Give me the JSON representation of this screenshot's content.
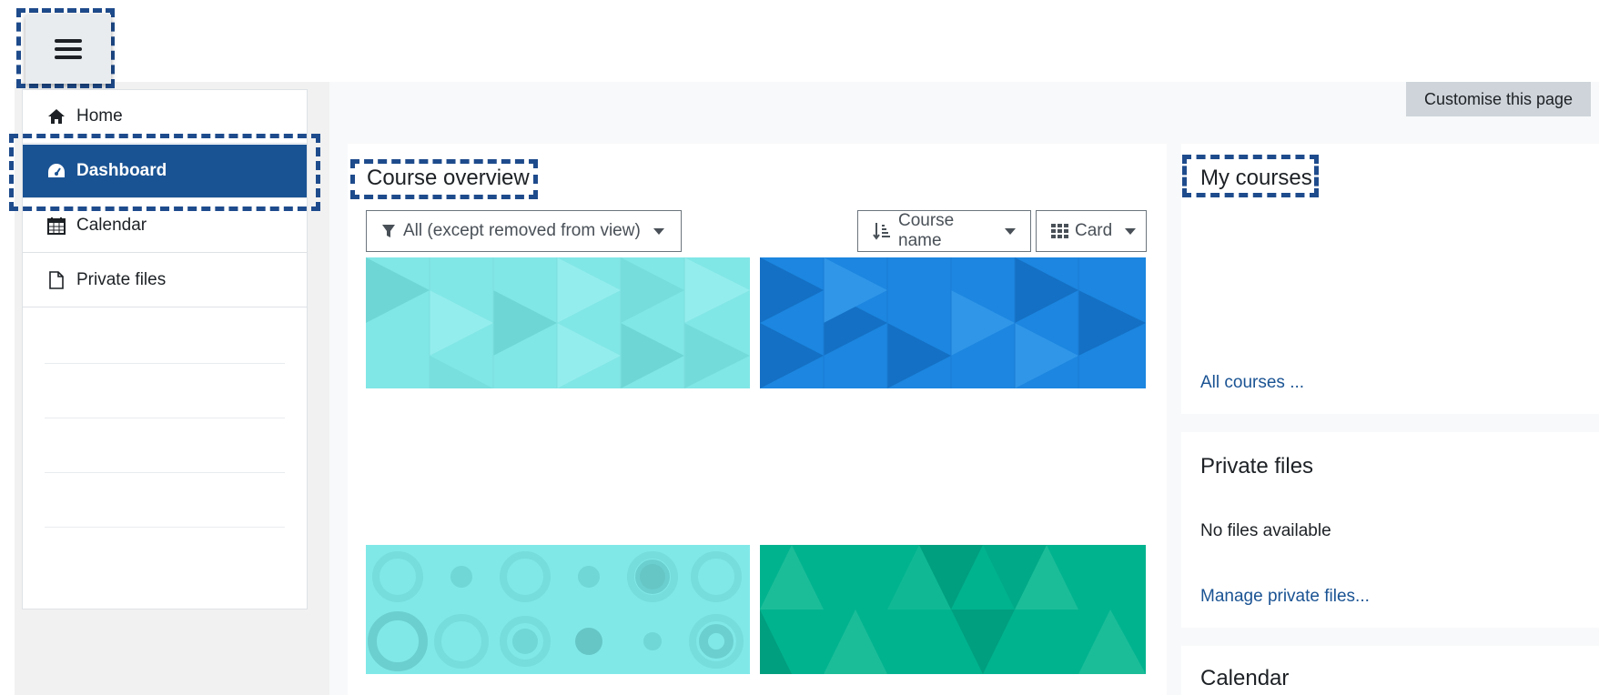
{
  "nav": {
    "items": [
      {
        "label": "Home",
        "icon": "home-icon",
        "active": false
      },
      {
        "label": "Dashboard",
        "icon": "dashboard-icon",
        "active": true
      },
      {
        "label": "Calendar",
        "icon": "calendar-icon",
        "active": false
      },
      {
        "label": "Private files",
        "icon": "file-icon",
        "active": false
      }
    ]
  },
  "header": {
    "customise_label": "Customise this page"
  },
  "course_overview": {
    "title": "Course overview",
    "filter_label": "All (except removed from view)",
    "sort_label": "Course name",
    "view_label": "Card",
    "course_colors": [
      "#81e6e6",
      "#1c86e0",
      "#81e6e6",
      "#00b38f"
    ]
  },
  "my_courses": {
    "title": "My courses",
    "link": "All courses ..."
  },
  "private_files": {
    "title": "Private files",
    "empty_text": "No files available",
    "link": "Manage private files..."
  },
  "calendar": {
    "title": "Calendar"
  }
}
